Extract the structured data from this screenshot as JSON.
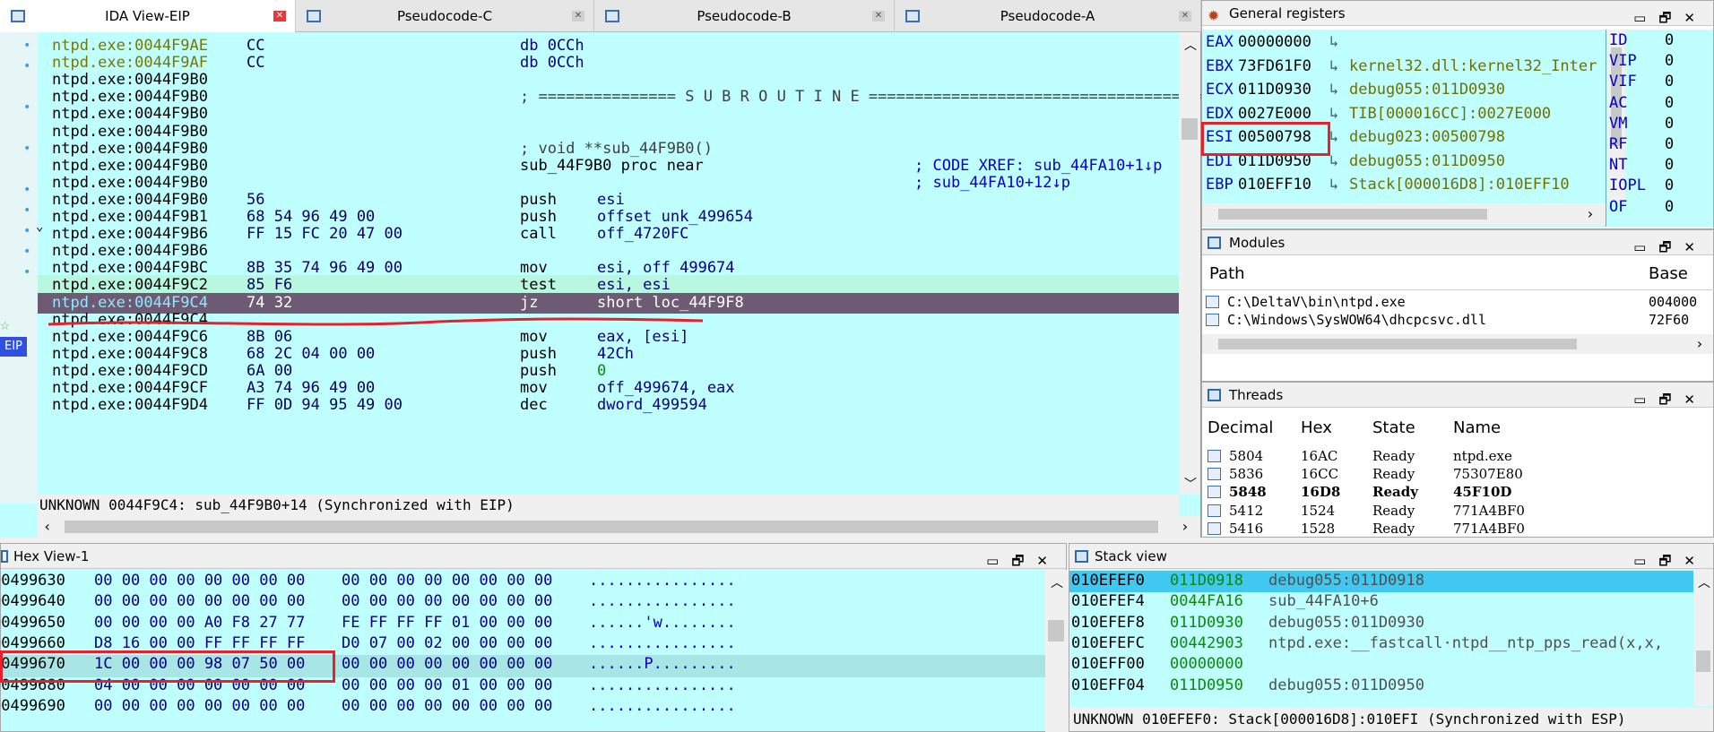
{
  "tabs": [
    {
      "label": "IDA View-EIP",
      "active": true
    },
    {
      "label": "Pseudocode-C",
      "active": false
    },
    {
      "label": "Pseudocode-B",
      "active": false
    },
    {
      "label": "Pseudocode-A",
      "active": false
    }
  ],
  "ida": {
    "lines": [
      {
        "addr": "ntpd.exe:0044F9AE",
        "bytes": "CC",
        "mn": "db 0CCh",
        "arg": "",
        "cmt": ""
      },
      {
        "addr": "ntpd.exe:0044F9AF",
        "bytes": "CC",
        "mn": "db 0CCh",
        "arg": "",
        "cmt": ""
      },
      {
        "addr": "ntpd.exe:0044F9B0",
        "bytes": "",
        "mn": "",
        "arg": "",
        "cmt": ""
      },
      {
        "addr": "ntpd.exe:0044F9B0",
        "bytes": "",
        "mn": "; =============== S U B R O U T I N E =======================================",
        "arg": "",
        "cmt": ""
      },
      {
        "addr": "ntpd.exe:0044F9B0",
        "bytes": "",
        "mn": "",
        "arg": "",
        "cmt": ""
      },
      {
        "addr": "ntpd.exe:0044F9B0",
        "bytes": "",
        "mn": "",
        "arg": "",
        "cmt": ""
      },
      {
        "addr": "ntpd.exe:0044F9B0",
        "bytes": "",
        "mn": "; void **sub_44F9B0()",
        "arg": "",
        "cmt": ""
      },
      {
        "addr": "ntpd.exe:0044F9B0",
        "bytes": "",
        "mn": "sub_44F9B0 proc near",
        "arg": "",
        "cmt": "; CODE XREF: sub_44FA10+1↓p"
      },
      {
        "addr": "ntpd.exe:0044F9B0",
        "bytes": "",
        "mn": "",
        "arg": "",
        "cmt": "; sub_44FA10+12↓p"
      },
      {
        "addr": "ntpd.exe:0044F9B0",
        "bytes": "56",
        "mn": "push",
        "arg": "esi",
        "cmt": ""
      },
      {
        "addr": "ntpd.exe:0044F9B1",
        "bytes": "68 54 96 49 00",
        "mn": "push",
        "arg": "offset unk_499654",
        "cmt": ""
      },
      {
        "addr": "ntpd.exe:0044F9B6",
        "bytes": "FF 15 FC 20 47 00",
        "mn": "call",
        "arg": "off_4720FC",
        "cmt": ""
      },
      {
        "addr": "ntpd.exe:0044F9B6",
        "bytes": "",
        "mn": "",
        "arg": "",
        "cmt": ""
      },
      {
        "addr": "ntpd.exe:0044F9BC",
        "bytes": "8B 35 74 96 49 00",
        "mn": "mov",
        "arg": "esi, off_499674",
        "cmt": ""
      },
      {
        "addr": "ntpd.exe:0044F9C2",
        "bytes": "85 F6",
        "mn": "test",
        "arg": "esi, esi",
        "cmt": ""
      },
      {
        "addr": "ntpd.exe:0044F9C4",
        "bytes": "74 32",
        "mn": "jz",
        "arg": "short loc_44F9F8",
        "cmt": ""
      },
      {
        "addr": "ntpd.exe:0044F9C4",
        "bytes": "",
        "mn": "",
        "arg": "",
        "cmt": ""
      },
      {
        "addr": "ntpd.exe:0044F9C6",
        "bytes": "8B 06",
        "mn": "mov",
        "arg": "eax, [esi]",
        "cmt": ""
      },
      {
        "addr": "ntpd.exe:0044F9C8",
        "bytes": "68 2C 04 00 00",
        "mn": "push",
        "arg": "42Ch",
        "cmt": ""
      },
      {
        "addr": "ntpd.exe:0044F9CD",
        "bytes": "6A 00",
        "mn": "push",
        "arg": "0",
        "cmt": ""
      },
      {
        "addr": "ntpd.exe:0044F9CF",
        "bytes": "A3 74 96 49 00",
        "mn": "mov",
        "arg": "off_499674, eax",
        "cmt": ""
      },
      {
        "addr": "ntpd.exe:0044F9D4",
        "bytes": "FF 0D 94 95 49 00",
        "mn": "dec",
        "arg": "dword_499594",
        "cmt": ""
      }
    ],
    "eip_label": "EIP",
    "status": "UNKNOWN 0044F9C4: sub_44F9B0+14 (Synchronized with EIP)"
  },
  "registers": {
    "title": "General registers",
    "items": [
      {
        "name": "EAX",
        "value": "00000000",
        "ref": ""
      },
      {
        "name": "EBX",
        "value": "73FD61F0",
        "ref": "kernel32.dll:kernel32_Inter"
      },
      {
        "name": "ECX",
        "value": "011D0930",
        "ref": "debug055:011D0930"
      },
      {
        "name": "EDX",
        "value": "0027E000",
        "ref": "TIB[000016CC]:0027E000"
      },
      {
        "name": "ESI",
        "value": "00500798",
        "ref": "debug023:00500798"
      },
      {
        "name": "EDI",
        "value": "011D0950",
        "ref": "debug055:011D0950"
      },
      {
        "name": "EBP",
        "value": "010EFF10",
        "ref": "Stack[000016D8]:010EFF10"
      }
    ],
    "flags": [
      {
        "name": "ID",
        "value": "0"
      },
      {
        "name": "VIP",
        "value": "0"
      },
      {
        "name": "VIF",
        "value": "0"
      },
      {
        "name": "AC",
        "value": "0"
      },
      {
        "name": "VM",
        "value": "0"
      },
      {
        "name": "RF",
        "value": "0"
      },
      {
        "name": "NT",
        "value": "0"
      },
      {
        "name": "IOPL",
        "value": "0"
      },
      {
        "name": "OF",
        "value": "0"
      }
    ]
  },
  "modules": {
    "title": "Modules",
    "col_path": "Path",
    "col_base": "Base",
    "rows": [
      {
        "path": "C:\\DeltaV\\bin\\ntpd.exe",
        "base": "004000"
      },
      {
        "path": "C:\\Windows\\SysWOW64\\dhcpcsvc.dll",
        "base": "72F60"
      }
    ]
  },
  "threads": {
    "title": "Threads",
    "cols": [
      "Decimal",
      "Hex",
      "State",
      "Name"
    ],
    "rows": [
      {
        "dec": "5804",
        "hex": "16AC",
        "state": "Ready",
        "name": "ntpd.exe"
      },
      {
        "dec": "5836",
        "hex": "16CC",
        "state": "Ready",
        "name": "75307E80"
      },
      {
        "dec": "5848",
        "hex": "16D8",
        "state": "Ready",
        "name": "45F10D"
      },
      {
        "dec": "5412",
        "hex": "1524",
        "state": "Ready",
        "name": "771A4BF0"
      },
      {
        "dec": "5416",
        "hex": "1528",
        "state": "Ready",
        "name": "771A4BF0"
      }
    ]
  },
  "hexview": {
    "title": "Hex View-1",
    "rows": [
      {
        "addr": "00499630",
        "b1": "00 00 00 00 00 00 00 00",
        "b2": "00 00 00 00 00 00 00 00",
        "ascii": "................"
      },
      {
        "addr": "00499640",
        "b1": "00 00 00 00 00 00 00 00",
        "b2": "00 00 00 00 00 00 00 00",
        "ascii": "................"
      },
      {
        "addr": "00499650",
        "b1": "00 00 00 00 A0 F8 27 77",
        "b2": "FE FF FF FF 01 00 00 00",
        "ascii": "......'w........"
      },
      {
        "addr": "00499660",
        "b1": "D8 16 00 00 FF FF FF FF",
        "b2": "D0 07 00 02 00 00 00 00",
        "ascii": "................"
      },
      {
        "addr": "00499670",
        "b1": "1C 00 00 00 98 07 50 00",
        "b2": "00 00 00 00 00 00 00 00",
        "ascii": "......P........."
      },
      {
        "addr": "00499680",
        "b1": "04 00 00 00 00 00 00 00",
        "b2": "00 00 00 00 01 00 00 00",
        "ascii": "................"
      },
      {
        "addr": "00499690",
        "b1": "00 00 00 00 00 00 00 00",
        "b2": "00 00 00 00 00 00 00 00",
        "ascii": "................"
      }
    ]
  },
  "stack": {
    "title": "Stack view",
    "rows": [
      {
        "addr": "010EFEF0",
        "val": "011D0918",
        "desc": "debug055:011D0918"
      },
      {
        "addr": "010EFEF4",
        "val": "0044FA16",
        "desc": "sub_44FA10+6"
      },
      {
        "addr": "010EFEF8",
        "val": "011D0930",
        "desc": "debug055:011D0930"
      },
      {
        "addr": "010EFEFC",
        "val": "00442903",
        "desc": "ntpd.exe:__fastcall·ntpd__ntp_pps_read(x,x,"
      },
      {
        "addr": "010EFF00",
        "val": "00000000",
        "desc": ""
      },
      {
        "addr": "010EFF04",
        "val": "011D0950",
        "desc": "debug055:011D0950"
      }
    ],
    "status": "UNKNOWN 010EFEF0: Stack[000016D8]:010EFI (Synchronized with ESP)"
  }
}
